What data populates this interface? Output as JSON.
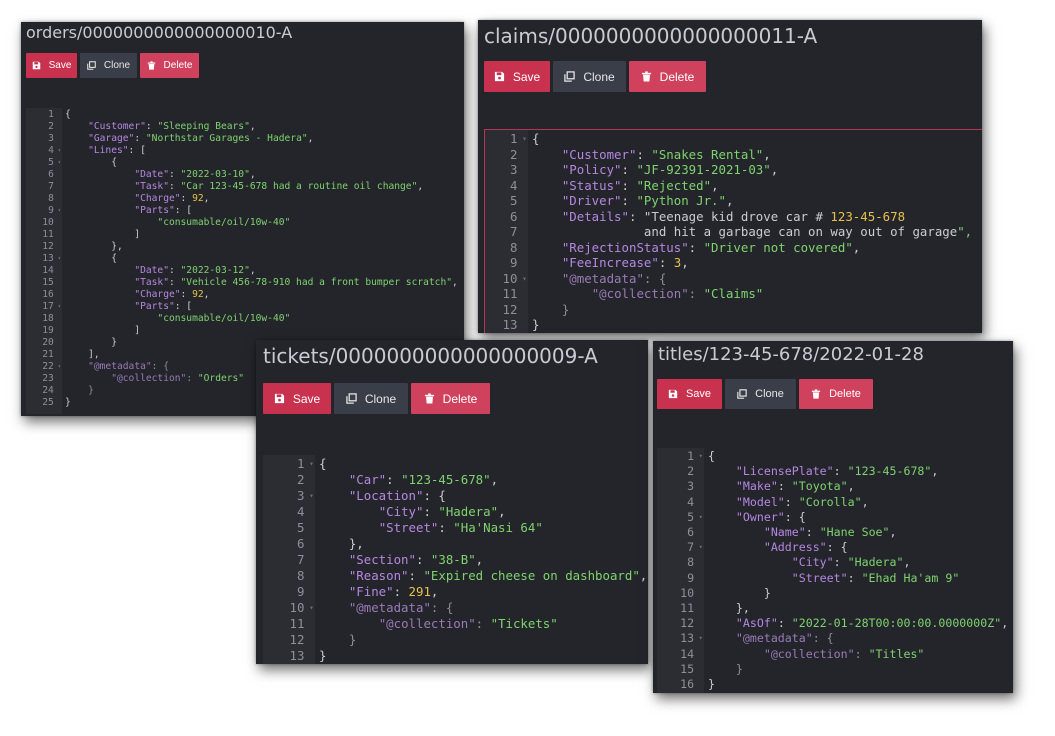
{
  "buttons": {
    "save": "Save",
    "clone": "Clone",
    "delete": "Delete"
  },
  "documents": {
    "orders": {
      "title": "orders/0000000000000000010-A",
      "lines": [
        "{",
        "    \"Customer\": \"Sleeping Bears\",",
        "    \"Garage\": \"Northstar Garages - Hadera\",",
        "    \"Lines\": [",
        "        {",
        "            \"Date\": \"2022-03-10\",",
        "            \"Task\": \"Car 123-45-678 had a routine oil change\",",
        "            \"Charge\": 92,",
        "            \"Parts\": [",
        "                \"consumable/oil/10w-40\"",
        "            ]",
        "        },",
        "        {",
        "            \"Date\": \"2022-03-12\",",
        "            \"Task\": \"Vehicle 456-78-910 had a front bumper scratch\",",
        "            \"Charge\": 92,",
        "            \"Parts\": [",
        "                \"consumable/oil/10w-40\"",
        "            ]",
        "        }",
        "    ],",
        "    \"@metadata\": {",
        "        \"@collection\": \"Orders\"",
        "    }",
        "}"
      ]
    },
    "claims": {
      "title": "claims/0000000000000000011-A",
      "lines": [
        "{",
        "    \"Customer\": \"Snakes Rental\",",
        "    \"Policy\": \"JF-92391-2021-03\",",
        "    \"Status\": \"Rejected\",",
        "    \"Driver\": \"Python Jr.\",",
        "    \"Details\": \"Teenage kid drove car # 123-45-678",
        "               and hit a garbage can on way out of garage\",",
        "    \"RejectionStatus\": \"Driver not covered\",",
        "    \"FeeIncrease\": 3,",
        "    \"@metadata\": {",
        "        \"@collection\": \"Claims\"",
        "    }",
        "}"
      ]
    },
    "tickets": {
      "title": "tickets/0000000000000000009-A",
      "lines": [
        "{",
        "    \"Car\": \"123-45-678\",",
        "    \"Location\": {",
        "        \"City\": \"Hadera\",",
        "        \"Street\": \"Ha'Nasi 64\"",
        "    },",
        "    \"Section\": \"38-B\",",
        "    \"Reason\": \"Expired cheese on dashboard\",",
        "    \"Fine\": 291,",
        "    \"@metadata\": {",
        "        \"@collection\": \"Tickets\"",
        "    }",
        "}"
      ]
    },
    "titles": {
      "title": "titles/123-45-678/2022-01-28",
      "lines": [
        "{",
        "    \"LicensePlate\": \"123-45-678\",",
        "    \"Make\": \"Toyota\",",
        "    \"Model\": \"Corolla\",",
        "    \"Owner\": {",
        "        \"Name\": \"Hane Soe\",",
        "        \"Address\": {",
        "            \"City\": \"Hadera\",",
        "            \"Street\": \"Ehad Ha'am 9\"",
        "        }",
        "    },",
        "    \"AsOf\": \"2022-01-28T00:00:00.0000000Z\",",
        "    \"@metadata\": {",
        "        \"@collection\": \"Titles\"",
        "    }",
        "}"
      ]
    }
  },
  "colors": {
    "save": "#c8324f",
    "delete": "#d0415d",
    "clone": "#3a3e48",
    "background": "#23252b",
    "key": "#b587e0",
    "string": "#7fd36e",
    "number": "#e6c24a"
  }
}
